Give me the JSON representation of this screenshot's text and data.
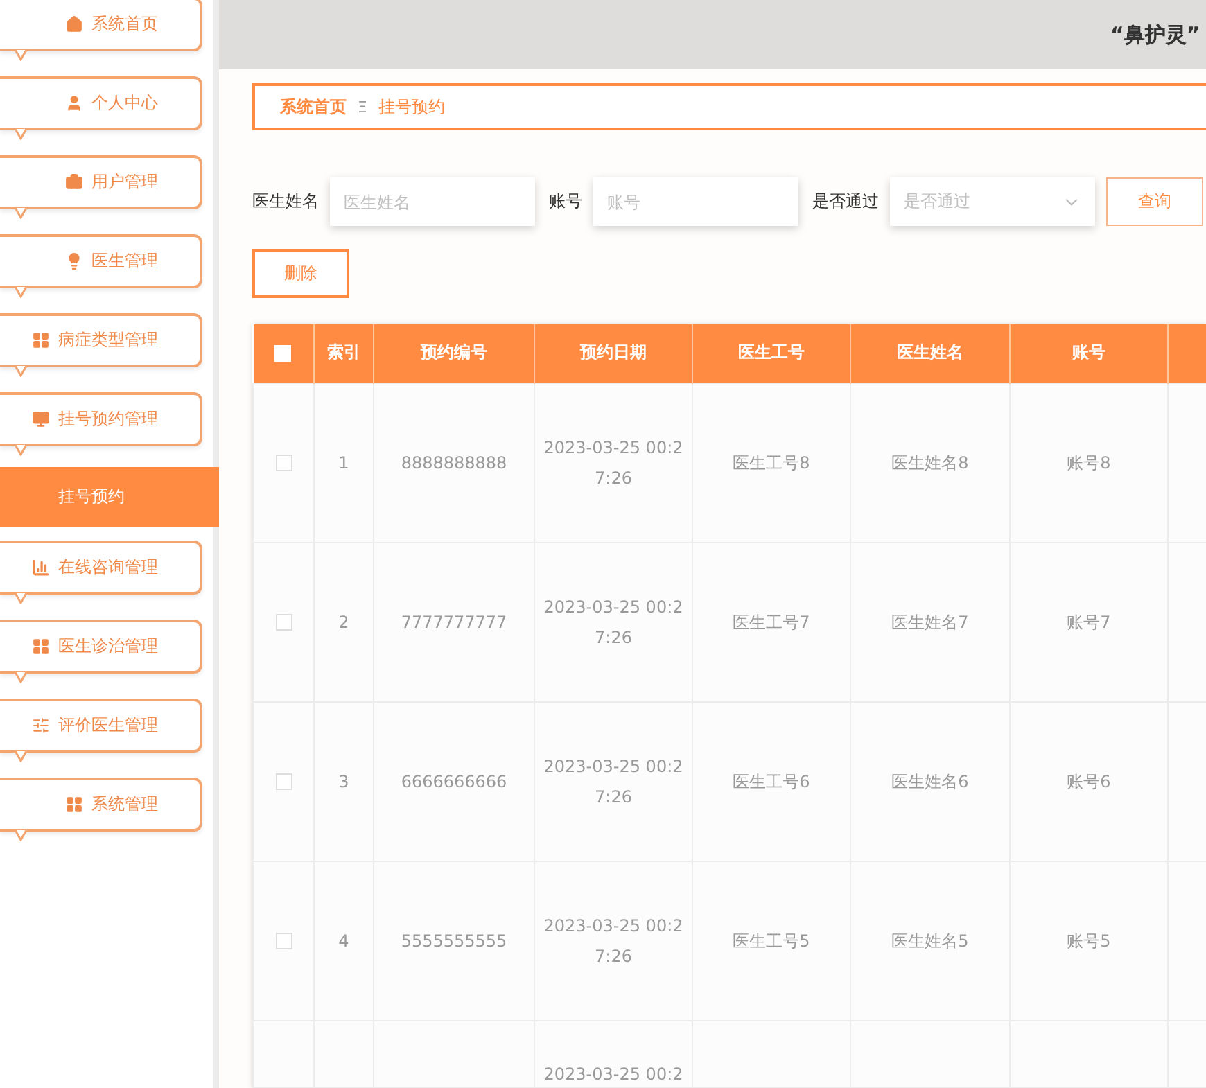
{
  "header": {
    "title": "“鼻护灵”"
  },
  "sidebar": {
    "items": [
      {
        "label": "系统首页"
      },
      {
        "label": "个人中心"
      },
      {
        "label": "用户管理"
      },
      {
        "label": "医生管理"
      },
      {
        "label": "病症类型管理"
      },
      {
        "label": "挂号预约管理",
        "children": [
          {
            "label": "挂号预约",
            "selected": true
          }
        ]
      },
      {
        "label": "在线咨询管理"
      },
      {
        "label": "医生诊治管理"
      },
      {
        "label": "评价医生管理"
      },
      {
        "label": "系统管理"
      }
    ]
  },
  "breadcrumb": {
    "items": [
      "系统首页",
      "挂号预约"
    ],
    "separator": "Ξ"
  },
  "search": {
    "fields": [
      {
        "kind": "text",
        "label": "医生姓名",
        "placeholder": "医生姓名"
      },
      {
        "kind": "text",
        "label": "账号",
        "placeholder": "账号"
      },
      {
        "kind": "select",
        "label": "是否通过",
        "placeholder": "是否通过"
      }
    ],
    "button": "查询"
  },
  "delete_button": "删除",
  "table": {
    "all_checked": false,
    "columns": [
      "索引",
      "预约编号",
      "预约日期",
      "医生工号",
      "医生姓名",
      "账号"
    ],
    "rows": [
      {
        "checked": false,
        "cells": [
          "1",
          "8888888888",
          "2023-03-25 00:27:26",
          "医生工号8",
          "医生姓名8",
          "账号8"
        ]
      },
      {
        "checked": false,
        "cells": [
          "2",
          "7777777777",
          "2023-03-25 00:27:26",
          "医生工号7",
          "医生姓名7",
          "账号7"
        ]
      },
      {
        "checked": false,
        "cells": [
          "3",
          "6666666666",
          "2023-03-25 00:27:26",
          "医生工号6",
          "医生姓名6",
          "账号6"
        ]
      },
      {
        "checked": false,
        "cells": [
          "4",
          "5555555555",
          "2023-03-25 00:27:26",
          "医生工号5",
          "医生姓名5",
          "账号5"
        ]
      }
    ],
    "partial_row": {
      "date": "2023-03-25 00:2"
    }
  }
}
